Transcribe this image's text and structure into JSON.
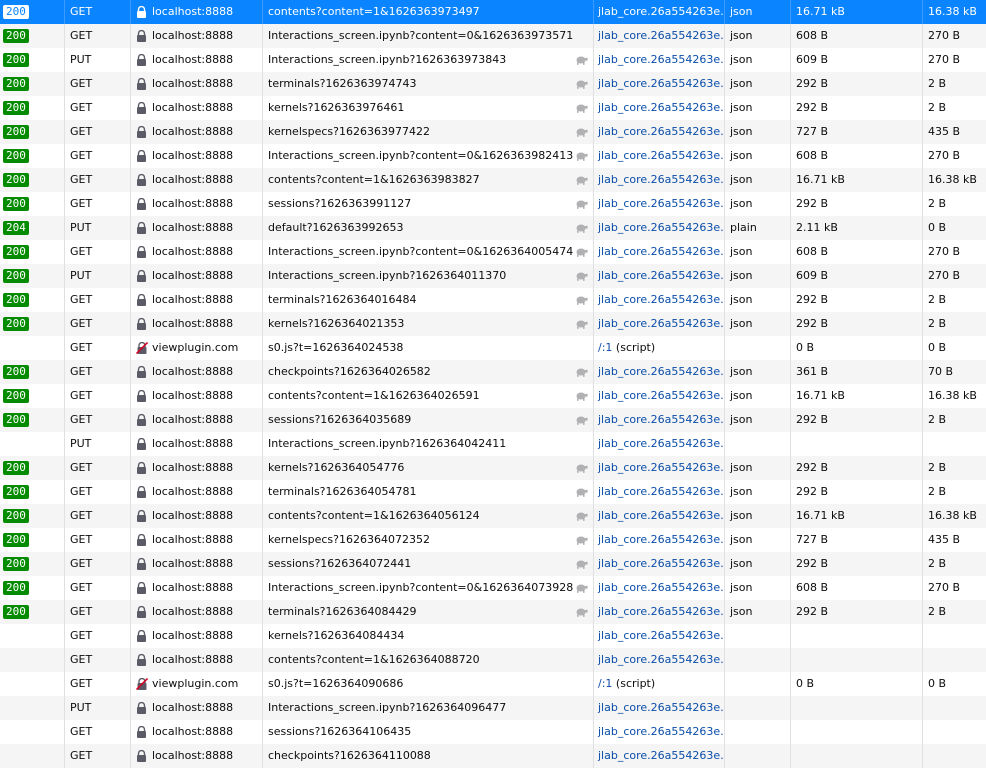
{
  "colors": {
    "selected_row": "#0a84ff",
    "status_ok": "#058b00",
    "initiator_link": "#0a4da8",
    "alt_row": "#f5f5f5"
  },
  "icons": {
    "secure": "lock-icon",
    "insecure": "blocked-lock-icon",
    "slow": "turtle-icon"
  },
  "requests": [
    {
      "status": "200",
      "method": "GET",
      "domain": "localhost:8888",
      "secure": true,
      "file": "contents?content=1&1626363973497",
      "slow": false,
      "initiator": "jlab_core.26a554263e…",
      "initiator_extra": "",
      "type": "json",
      "transferred": "16.71 kB",
      "size": "16.38 kB",
      "selected": true
    },
    {
      "status": "200",
      "method": "GET",
      "domain": "localhost:8888",
      "secure": true,
      "file": "Interactions_screen.ipynb?content=0&1626363973571",
      "slow": false,
      "initiator": "jlab_core.26a554263e…",
      "initiator_extra": "",
      "type": "json",
      "transferred": "608 B",
      "size": "270 B",
      "selected": false
    },
    {
      "status": "200",
      "method": "PUT",
      "domain": "localhost:8888",
      "secure": true,
      "file": "Interactions_screen.ipynb?1626363973843",
      "slow": true,
      "initiator": "jlab_core.26a554263e…",
      "initiator_extra": "",
      "type": "json",
      "transferred": "609 B",
      "size": "270 B",
      "selected": false
    },
    {
      "status": "200",
      "method": "GET",
      "domain": "localhost:8888",
      "secure": true,
      "file": "terminals?1626363974743",
      "slow": true,
      "initiator": "jlab_core.26a554263e…",
      "initiator_extra": "",
      "type": "json",
      "transferred": "292 B",
      "size": "2 B",
      "selected": false
    },
    {
      "status": "200",
      "method": "GET",
      "domain": "localhost:8888",
      "secure": true,
      "file": "kernels?1626363976461",
      "slow": true,
      "initiator": "jlab_core.26a554263e…",
      "initiator_extra": "",
      "type": "json",
      "transferred": "292 B",
      "size": "2 B",
      "selected": false
    },
    {
      "status": "200",
      "method": "GET",
      "domain": "localhost:8888",
      "secure": true,
      "file": "kernelspecs?1626363977422",
      "slow": true,
      "initiator": "jlab_core.26a554263e…",
      "initiator_extra": "",
      "type": "json",
      "transferred": "727 B",
      "size": "435 B",
      "selected": false
    },
    {
      "status": "200",
      "method": "GET",
      "domain": "localhost:8888",
      "secure": true,
      "file": "Interactions_screen.ipynb?content=0&1626363982413",
      "slow": true,
      "initiator": "jlab_core.26a554263e…",
      "initiator_extra": "",
      "type": "json",
      "transferred": "608 B",
      "size": "270 B",
      "selected": false
    },
    {
      "status": "200",
      "method": "GET",
      "domain": "localhost:8888",
      "secure": true,
      "file": "contents?content=1&1626363983827",
      "slow": true,
      "initiator": "jlab_core.26a554263e…",
      "initiator_extra": "",
      "type": "json",
      "transferred": "16.71 kB",
      "size": "16.38 kB",
      "selected": false
    },
    {
      "status": "200",
      "method": "GET",
      "domain": "localhost:8888",
      "secure": true,
      "file": "sessions?1626363991127",
      "slow": true,
      "initiator": "jlab_core.26a554263e…",
      "initiator_extra": "",
      "type": "json",
      "transferred": "292 B",
      "size": "2 B",
      "selected": false
    },
    {
      "status": "204",
      "method": "PUT",
      "domain": "localhost:8888",
      "secure": true,
      "file": "default?1626363992653",
      "slow": true,
      "initiator": "jlab_core.26a554263e…",
      "initiator_extra": "",
      "type": "plain",
      "transferred": "2.11 kB",
      "size": "0 B",
      "selected": false
    },
    {
      "status": "200",
      "method": "GET",
      "domain": "localhost:8888",
      "secure": true,
      "file": "Interactions_screen.ipynb?content=0&1626364005474",
      "slow": true,
      "initiator": "jlab_core.26a554263e…",
      "initiator_extra": "",
      "type": "json",
      "transferred": "608 B",
      "size": "270 B",
      "selected": false
    },
    {
      "status": "200",
      "method": "PUT",
      "domain": "localhost:8888",
      "secure": true,
      "file": "Interactions_screen.ipynb?1626364011370",
      "slow": true,
      "initiator": "jlab_core.26a554263e…",
      "initiator_extra": "",
      "type": "json",
      "transferred": "609 B",
      "size": "270 B",
      "selected": false
    },
    {
      "status": "200",
      "method": "GET",
      "domain": "localhost:8888",
      "secure": true,
      "file": "terminals?1626364016484",
      "slow": true,
      "initiator": "jlab_core.26a554263e…",
      "initiator_extra": "",
      "type": "json",
      "transferred": "292 B",
      "size": "2 B",
      "selected": false
    },
    {
      "status": "200",
      "method": "GET",
      "domain": "localhost:8888",
      "secure": true,
      "file": "kernels?1626364021353",
      "slow": true,
      "initiator": "jlab_core.26a554263e…",
      "initiator_extra": "",
      "type": "json",
      "transferred": "292 B",
      "size": "2 B",
      "selected": false
    },
    {
      "status": "",
      "method": "GET",
      "domain": "viewplugin.com",
      "secure": false,
      "file": "s0.js?t=1626364024538",
      "slow": false,
      "initiator": "/:1",
      "initiator_extra": " (script)",
      "type": "",
      "transferred": "0 B",
      "size": "0 B",
      "selected": false
    },
    {
      "status": "200",
      "method": "GET",
      "domain": "localhost:8888",
      "secure": true,
      "file": "checkpoints?1626364026582",
      "slow": true,
      "initiator": "jlab_core.26a554263e…",
      "initiator_extra": "",
      "type": "json",
      "transferred": "361 B",
      "size": "70 B",
      "selected": false
    },
    {
      "status": "200",
      "method": "GET",
      "domain": "localhost:8888",
      "secure": true,
      "file": "contents?content=1&1626364026591",
      "slow": true,
      "initiator": "jlab_core.26a554263e…",
      "initiator_extra": "",
      "type": "json",
      "transferred": "16.71 kB",
      "size": "16.38 kB",
      "selected": false
    },
    {
      "status": "200",
      "method": "GET",
      "domain": "localhost:8888",
      "secure": true,
      "file": "sessions?1626364035689",
      "slow": true,
      "initiator": "jlab_core.26a554263e…",
      "initiator_extra": "",
      "type": "json",
      "transferred": "292 B",
      "size": "2 B",
      "selected": false
    },
    {
      "status": "",
      "method": "PUT",
      "domain": "localhost:8888",
      "secure": true,
      "file": "Interactions_screen.ipynb?1626364042411",
      "slow": false,
      "initiator": "jlab_core.26a554263e…",
      "initiator_extra": "",
      "type": "",
      "transferred": "",
      "size": "",
      "selected": false
    },
    {
      "status": "200",
      "method": "GET",
      "domain": "localhost:8888",
      "secure": true,
      "file": "kernels?1626364054776",
      "slow": true,
      "initiator": "jlab_core.26a554263e…",
      "initiator_extra": "",
      "type": "json",
      "transferred": "292 B",
      "size": "2 B",
      "selected": false
    },
    {
      "status": "200",
      "method": "GET",
      "domain": "localhost:8888",
      "secure": true,
      "file": "terminals?1626364054781",
      "slow": true,
      "initiator": "jlab_core.26a554263e…",
      "initiator_extra": "",
      "type": "json",
      "transferred": "292 B",
      "size": "2 B",
      "selected": false
    },
    {
      "status": "200",
      "method": "GET",
      "domain": "localhost:8888",
      "secure": true,
      "file": "contents?content=1&1626364056124",
      "slow": true,
      "initiator": "jlab_core.26a554263e…",
      "initiator_extra": "",
      "type": "json",
      "transferred": "16.71 kB",
      "size": "16.38 kB",
      "selected": false
    },
    {
      "status": "200",
      "method": "GET",
      "domain": "localhost:8888",
      "secure": true,
      "file": "kernelspecs?1626364072352",
      "slow": true,
      "initiator": "jlab_core.26a554263e…",
      "initiator_extra": "",
      "type": "json",
      "transferred": "727 B",
      "size": "435 B",
      "selected": false
    },
    {
      "status": "200",
      "method": "GET",
      "domain": "localhost:8888",
      "secure": true,
      "file": "sessions?1626364072441",
      "slow": true,
      "initiator": "jlab_core.26a554263e…",
      "initiator_extra": "",
      "type": "json",
      "transferred": "292 B",
      "size": "2 B",
      "selected": false
    },
    {
      "status": "200",
      "method": "GET",
      "domain": "localhost:8888",
      "secure": true,
      "file": "Interactions_screen.ipynb?content=0&1626364073928",
      "slow": true,
      "initiator": "jlab_core.26a554263e…",
      "initiator_extra": "",
      "type": "json",
      "transferred": "608 B",
      "size": "270 B",
      "selected": false
    },
    {
      "status": "200",
      "method": "GET",
      "domain": "localhost:8888",
      "secure": true,
      "file": "terminals?1626364084429",
      "slow": true,
      "initiator": "jlab_core.26a554263e…",
      "initiator_extra": "",
      "type": "json",
      "transferred": "292 B",
      "size": "2 B",
      "selected": false
    },
    {
      "status": "",
      "method": "GET",
      "domain": "localhost:8888",
      "secure": true,
      "file": "kernels?1626364084434",
      "slow": false,
      "initiator": "jlab_core.26a554263e…",
      "initiator_extra": "",
      "type": "",
      "transferred": "",
      "size": "",
      "selected": false
    },
    {
      "status": "",
      "method": "GET",
      "domain": "localhost:8888",
      "secure": true,
      "file": "contents?content=1&1626364088720",
      "slow": false,
      "initiator": "jlab_core.26a554263e…",
      "initiator_extra": "",
      "type": "",
      "transferred": "",
      "size": "",
      "selected": false
    },
    {
      "status": "",
      "method": "GET",
      "domain": "viewplugin.com",
      "secure": false,
      "file": "s0.js?t=1626364090686",
      "slow": false,
      "initiator": "/:1",
      "initiator_extra": " (script)",
      "type": "",
      "transferred": "0 B",
      "size": "0 B",
      "selected": false
    },
    {
      "status": "",
      "method": "PUT",
      "domain": "localhost:8888",
      "secure": true,
      "file": "Interactions_screen.ipynb?1626364096477",
      "slow": false,
      "initiator": "jlab_core.26a554263e…",
      "initiator_extra": "",
      "type": "",
      "transferred": "",
      "size": "",
      "selected": false
    },
    {
      "status": "",
      "method": "GET",
      "domain": "localhost:8888",
      "secure": true,
      "file": "sessions?1626364106435",
      "slow": false,
      "initiator": "jlab_core.26a554263e…",
      "initiator_extra": "",
      "type": "",
      "transferred": "",
      "size": "",
      "selected": false
    },
    {
      "status": "",
      "method": "GET",
      "domain": "localhost:8888",
      "secure": true,
      "file": "checkpoints?1626364110088",
      "slow": false,
      "initiator": "jlab_core.26a554263e…",
      "initiator_extra": "",
      "type": "",
      "transferred": "",
      "size": "",
      "selected": false
    }
  ]
}
